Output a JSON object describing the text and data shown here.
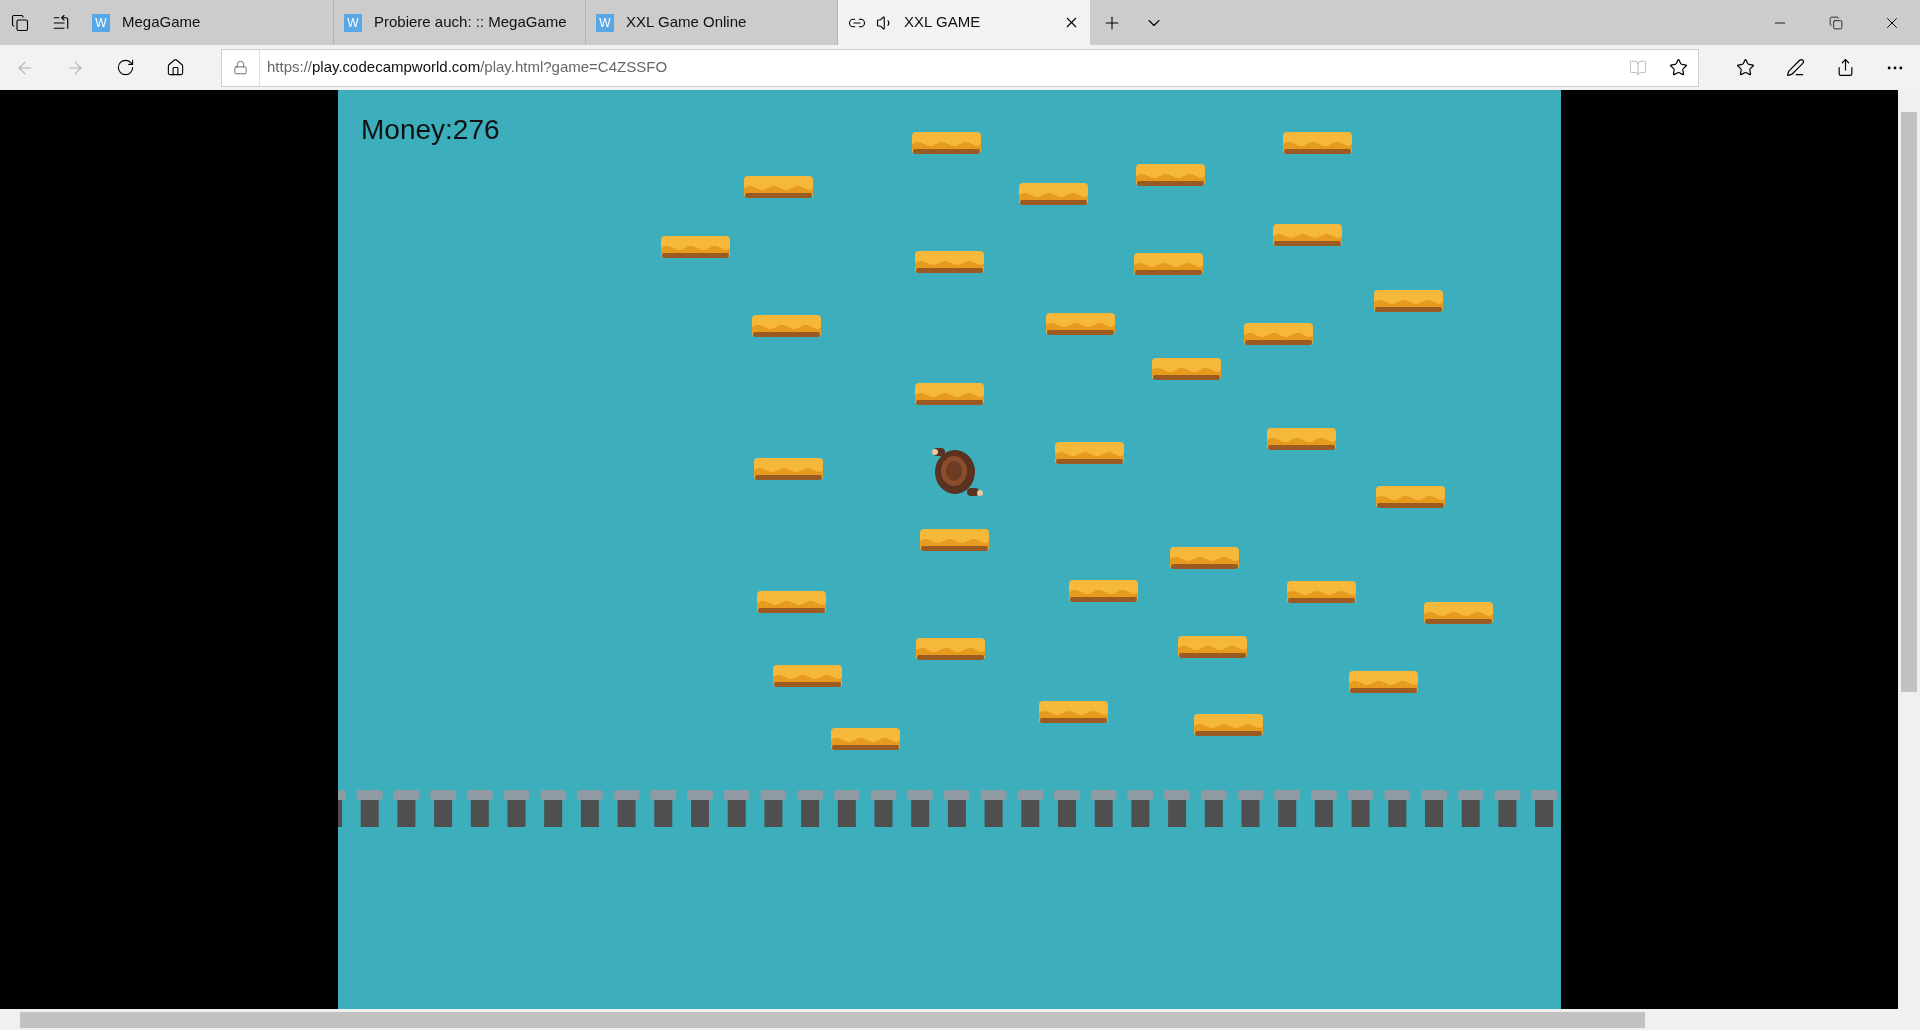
{
  "tabs": [
    {
      "title": "MegaGame",
      "favicon_letter": "W",
      "selected": false,
      "audio": false
    },
    {
      "title": "Probiere auch: :: MegaGame",
      "favicon_letter": "W",
      "selected": false,
      "audio": false
    },
    {
      "title": "XXL Game Online",
      "favicon_letter": "W",
      "selected": false,
      "audio": false
    },
    {
      "title": "XXL GAME",
      "selected": true,
      "audio": true
    }
  ],
  "address_bar": {
    "scheme": "https://",
    "host": "play.codecampworld.com",
    "path": "/play.html?game=C4ZSSFO"
  },
  "game": {
    "money": "Money:276"
  }
}
